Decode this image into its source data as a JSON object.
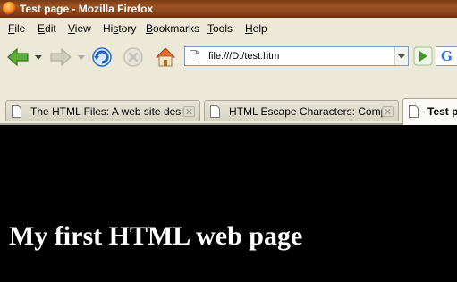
{
  "window": {
    "title": "Test page - Mozilla Firefox"
  },
  "menu": [
    {
      "key": "F",
      "rest": "ile"
    },
    {
      "key": "E",
      "rest": "dit"
    },
    {
      "key": "V",
      "rest": "iew"
    },
    {
      "pre": "Hi",
      "key": "s",
      "rest": "tory"
    },
    {
      "key": "B",
      "rest": "ookmarks"
    },
    {
      "key": "T",
      "rest": "ools"
    },
    {
      "key": "H",
      "rest": "elp"
    }
  ],
  "address": {
    "url": "file:///D:/test.htm"
  },
  "search": {
    "engine_letter": "G"
  },
  "tabs": [
    {
      "label": "The HTML Files: A web site desig..."
    },
    {
      "label": "HTML Escape Characters: Compl..."
    },
    {
      "label": "Test p"
    }
  ],
  "page": {
    "heading": "My first HTML web page"
  },
  "colors": {
    "titlebar": "#8a4418",
    "chrome": "#ece9d8",
    "page_background": "#000000",
    "page_text": "#ffffff"
  }
}
